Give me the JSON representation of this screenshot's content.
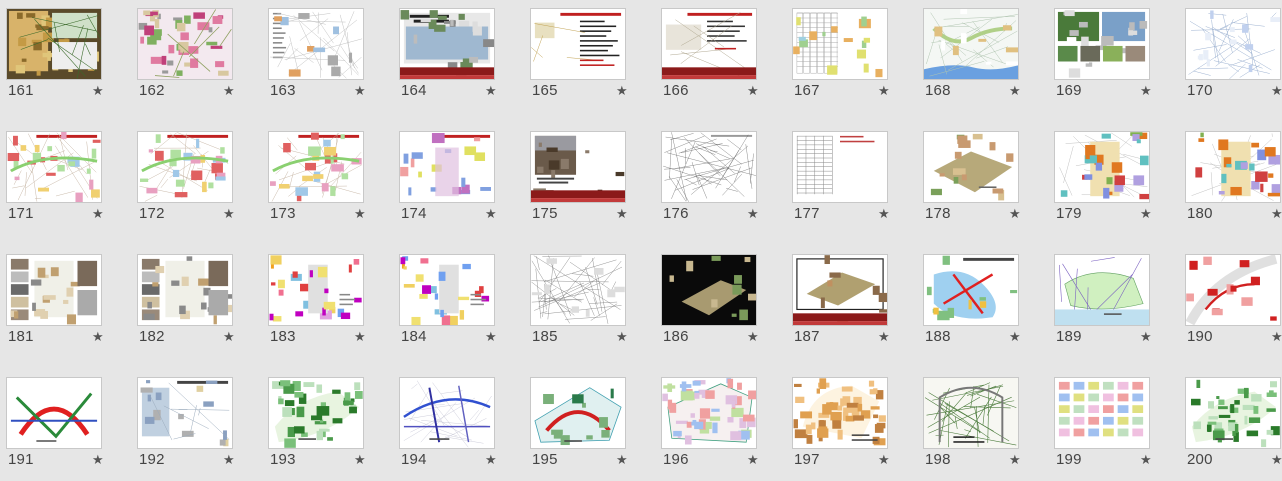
{
  "star_glyph": "★",
  "slides": [
    {
      "number": "161",
      "kind": "photo-map",
      "caption": ""
    },
    {
      "number": "162",
      "kind": "render-collage",
      "caption": ""
    },
    {
      "number": "163",
      "kind": "site-plan",
      "caption": ""
    },
    {
      "number": "164",
      "kind": "title-photo",
      "caption": ""
    },
    {
      "number": "165",
      "kind": "text-slide",
      "caption": ""
    },
    {
      "number": "166",
      "kind": "text-photo",
      "caption": ""
    },
    {
      "number": "167",
      "kind": "table-chart",
      "caption": ""
    },
    {
      "number": "168",
      "kind": "map-blue",
      "caption": ""
    },
    {
      "number": "169",
      "kind": "photo-grid",
      "caption": ""
    },
    {
      "number": "170",
      "kind": "line-plan",
      "caption": ""
    },
    {
      "number": "171",
      "kind": "color-plan",
      "caption": ""
    },
    {
      "number": "172",
      "kind": "color-plan",
      "caption": ""
    },
    {
      "number": "173",
      "kind": "color-plan",
      "caption": ""
    },
    {
      "number": "174",
      "kind": "color-plan-mid",
      "caption": ""
    },
    {
      "number": "175",
      "kind": "title-photo-dark",
      "caption": ""
    },
    {
      "number": "176",
      "kind": "sketches",
      "caption": ""
    },
    {
      "number": "177",
      "kind": "table",
      "caption": ""
    },
    {
      "number": "178",
      "kind": "model-3d",
      "caption": ""
    },
    {
      "number": "179",
      "kind": "master-plan",
      "caption": ""
    },
    {
      "number": "180",
      "kind": "master-plan-2",
      "caption": ""
    },
    {
      "number": "181",
      "kind": "elevations",
      "caption": ""
    },
    {
      "number": "182",
      "kind": "elevations",
      "caption": ""
    },
    {
      "number": "183",
      "kind": "zoning",
      "caption": ""
    },
    {
      "number": "184",
      "kind": "zoning",
      "caption": ""
    },
    {
      "number": "185",
      "kind": "floor-plan",
      "caption": ""
    },
    {
      "number": "186",
      "kind": "model-dark",
      "caption": ""
    },
    {
      "number": "187",
      "kind": "model-frame",
      "caption": ""
    },
    {
      "number": "188",
      "kind": "concept-arrows",
      "caption": ""
    },
    {
      "number": "189",
      "kind": "concept-blob",
      "caption": ""
    },
    {
      "number": "190",
      "kind": "concept-red",
      "caption": ""
    },
    {
      "number": "191",
      "kind": "concept-arc",
      "caption": ""
    },
    {
      "number": "192",
      "kind": "diagram-photos",
      "caption": ""
    },
    {
      "number": "193",
      "kind": "green-plan",
      "caption": ""
    },
    {
      "number": "194",
      "kind": "road-plan",
      "caption": ""
    },
    {
      "number": "195",
      "kind": "arc-plan",
      "caption": ""
    },
    {
      "number": "196",
      "kind": "dense-plan",
      "caption": ""
    },
    {
      "number": "197",
      "kind": "orange-plan",
      "caption": ""
    },
    {
      "number": "198",
      "kind": "sketch-trees",
      "caption": ""
    },
    {
      "number": "199",
      "kind": "icon-sheet",
      "caption": ""
    },
    {
      "number": "200",
      "kind": "green-plan-2",
      "caption": ""
    }
  ]
}
